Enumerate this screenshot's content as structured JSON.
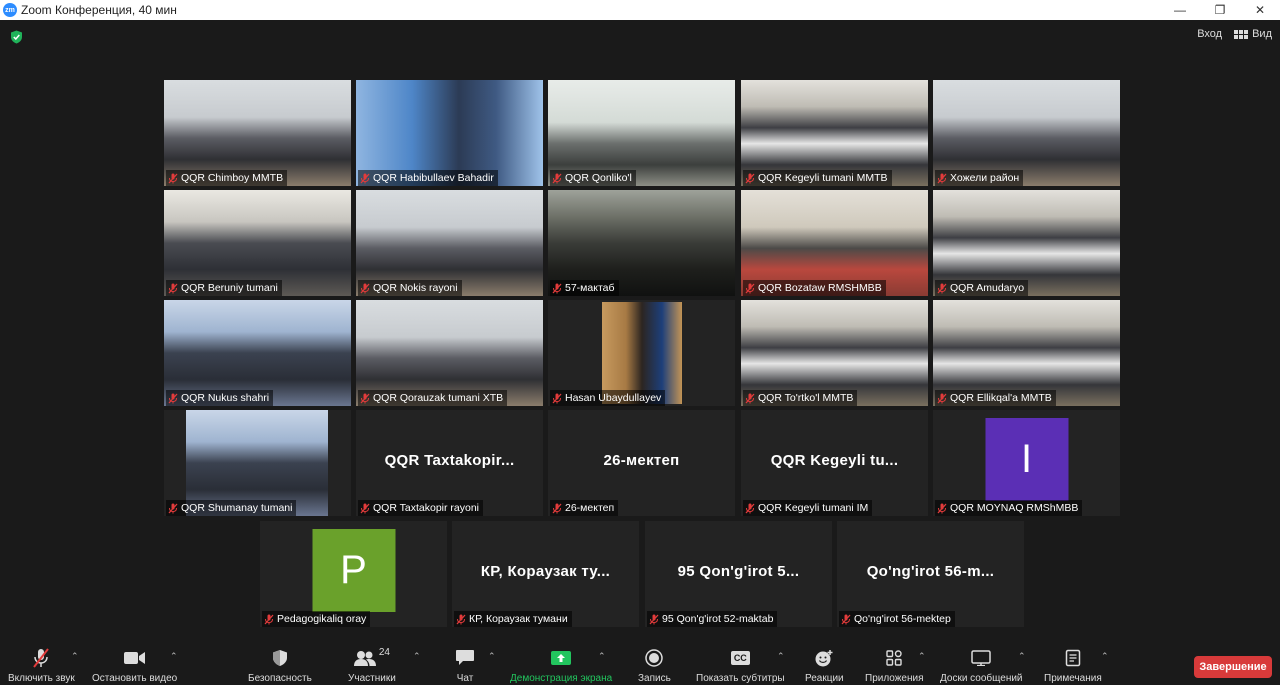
{
  "window": {
    "title": "Zoom Конференция, 40 мин",
    "logo_text": "zm"
  },
  "topbar": {
    "exit_label": "Вход",
    "view_label": "Вид"
  },
  "tiles": [
    {
      "name": "QQR  Chimboy MMTB",
      "type": "video",
      "palette": "classroom_light"
    },
    {
      "name": "QQR Habibullaev Bahadir",
      "type": "video",
      "palette": "person_blue"
    },
    {
      "name": "QQR Qonliko'l",
      "type": "video",
      "palette": "hall_bright"
    },
    {
      "name": "QQR Kegeyli tumani MMTB",
      "type": "video",
      "palette": "classroom_crowd"
    },
    {
      "name": "Хожели район",
      "type": "video",
      "palette": "classroom_light"
    },
    {
      "name": "QQR Beruniy tumani",
      "type": "video",
      "palette": "meeting_room"
    },
    {
      "name": "QQR Nokis rayoni",
      "type": "video",
      "palette": "classroom_light"
    },
    {
      "name": "57-мактаб",
      "type": "video",
      "palette": "dark_silhouette"
    },
    {
      "name": "QQR Bozataw RMSHMBB",
      "type": "video",
      "palette": "red_desk"
    },
    {
      "name": "QQR Amudaryo",
      "type": "video",
      "palette": "classroom_crowd"
    },
    {
      "name": "QQR Nukus shahri",
      "type": "video",
      "palette": "hall_blue"
    },
    {
      "name": "QQR Qorauzak tumani XTB",
      "type": "video",
      "palette": "classroom_light"
    },
    {
      "name": "Hasan Ubaydullayev",
      "type": "video",
      "palette": "speaker",
      "active": true
    },
    {
      "name": "QQR To'rtko'l MMTB",
      "type": "video",
      "palette": "classroom_crowd"
    },
    {
      "name": "QQR Ellikqal'a MMTB",
      "type": "video",
      "palette": "classroom_crowd"
    },
    {
      "name": "QQR Shumanay tumani",
      "type": "video",
      "palette": "hall_blue"
    },
    {
      "name": "QQR Taxtakopir rayoni",
      "type": "text",
      "big": "QQR  Taxtakopir..."
    },
    {
      "name": "26-мектеп",
      "type": "text",
      "big": "26-мектеп"
    },
    {
      "name": "QQR Kegeyli tumani IM",
      "type": "text",
      "big": "QQR  Kegeyli  tu..."
    },
    {
      "name": "QQR MOYNAQ RMShMBB",
      "type": "avatar",
      "letter": "I",
      "color": "#5b2fb5"
    },
    {
      "name": "Pedagogikaliq oray",
      "type": "avatar",
      "letter": "P",
      "color": "#6aa12b"
    },
    {
      "name": "КР, Кораузак тумани",
      "type": "text",
      "big": "КР, Кораузак ту..."
    },
    {
      "name": "95 Qon'g'irot 52-maktab",
      "type": "text",
      "big": "95 Qon'g'irot 5..."
    },
    {
      "name": "Qo'ng'irot 56-mektep",
      "type": "text",
      "big": "Qo'ng'irot 56-m..."
    }
  ],
  "toolbar": {
    "unmute": "Включить звук",
    "stop_video": "Остановить видео",
    "security": "Безопасность",
    "participants": "Участники",
    "participants_count": "24",
    "chat": "Чат",
    "share": "Демонстрация экрана",
    "record": "Запись",
    "captions": "Показать субтитры",
    "captions_icon": "CC",
    "reactions": "Реакции",
    "apps": "Приложения",
    "whiteboards": "Доски сообщений",
    "notes": "Примечания",
    "end": "Завершение"
  },
  "colors": {
    "share_green": "#22c55e",
    "end_red": "#d83a3a",
    "active_speaker": "#e6e27a"
  }
}
